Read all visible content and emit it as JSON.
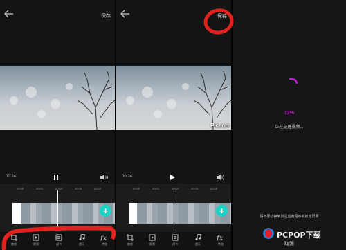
{
  "panels": [
    {
      "save_label": "保存",
      "time": "00:24",
      "play_state": "pause",
      "ticks": [
        "00:00",
        "00:02",
        "00:04",
        "00:06",
        "00:08"
      ],
      "tools": [
        {
          "icon": "crop-icon",
          "label": "裁剪"
        },
        {
          "icon": "video-icon",
          "label": "视频"
        },
        {
          "icon": "adjust-icon",
          "label": "调节"
        },
        {
          "icon": "music-icon",
          "label": "音乐"
        },
        {
          "icon": "fx-icon",
          "label": "特效"
        }
      ]
    },
    {
      "save_label": "保存",
      "watermark": "Picsort",
      "time": "00:24",
      "play_state": "play",
      "ticks": [
        "00:00",
        "00:02",
        "00:04",
        "00:06",
        "00:08"
      ],
      "tools": [
        {
          "icon": "crop-icon",
          "label": "裁剪"
        },
        {
          "icon": "video-icon",
          "label": "视频"
        },
        {
          "icon": "adjust-icon",
          "label": "调节"
        },
        {
          "icon": "music-icon",
          "label": "音乐"
        },
        {
          "icon": "fx-icon",
          "label": "特效"
        }
      ]
    }
  ],
  "processing": {
    "percent": "12%",
    "status": "正在处理视频...",
    "warning": "请不要切换到其它应用程序或锁定屏幕",
    "cancel_label": "取消"
  },
  "logo": {
    "text": "PCPOP下载"
  },
  "colors": {
    "accent_add": "#19d3c5",
    "progress": "#c21fd4",
    "annotation": "#e0231f"
  }
}
